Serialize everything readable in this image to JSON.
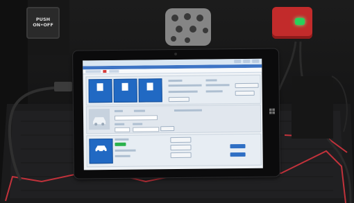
{
  "photo": {
    "push_button": {
      "line1": "PUSH",
      "line2": "ON•OFF"
    },
    "colors": {
      "interior": "#141414",
      "carpet_trim": "#c2323b",
      "device_body": "#c22b2b",
      "device_led": "#27d15a",
      "screen_bg": "#eef2f6",
      "tile_blue": "#2169c3",
      "status_green": "#2bb24c"
    },
    "icons": [
      "gear-selector-icon",
      "windows-logo-icon",
      "car-icon"
    ]
  }
}
